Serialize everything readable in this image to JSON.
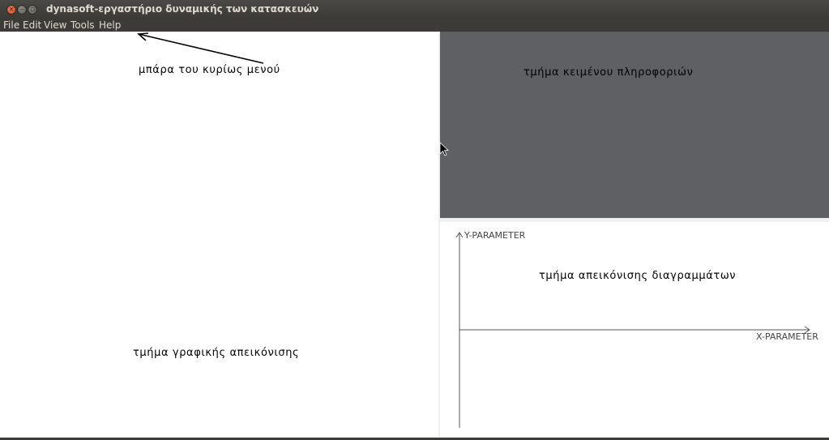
{
  "window": {
    "title": "dynasoft-εργαστήριο δυναμικής των κατασκευών",
    "close_glyph": "×",
    "minimize_glyph": "–",
    "maximize_glyph": "▫"
  },
  "menu": {
    "items": [
      "File",
      "Edit",
      "View",
      "Tools",
      "Help"
    ]
  },
  "annotations": {
    "menu_bar": "μπάρα του κυρίως μενού",
    "info_text": "τμήμα κειμένου πληροφοριών",
    "charts": "τμήμα απεικόνισης διαγραμμάτων",
    "graphics": "τμήμα γραφικής απεικόνισης"
  },
  "chart": {
    "y_axis_label": "Y-PARAMETER",
    "x_axis_label": "X-PARAMETER"
  },
  "colors": {
    "title_bar": "#3c3b37",
    "info_pane": "#5f6063",
    "close_button": "#e95420"
  },
  "icons": {
    "close": "close-icon",
    "minimize": "minimize-icon",
    "maximize": "maximize-icon",
    "cursor": "mouse-cursor-icon",
    "arrow": "annotation-arrow-icon"
  }
}
